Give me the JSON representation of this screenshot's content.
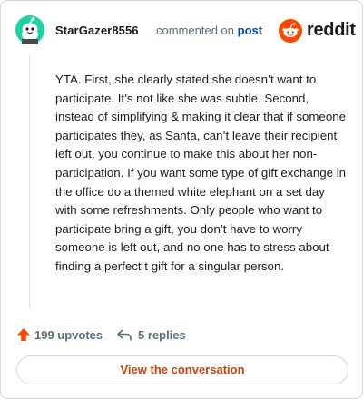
{
  "header": {
    "username": "StarGazer8556",
    "commented_text": "commented on",
    "post_link": "post",
    "brand": "reddit"
  },
  "comment": {
    "body": "YTA. First, she clearly stated she doesn’t want to participate. It’s not like she was subtle. Second, instead of simplifying & making it clear that if someone participates they, as Santa, can’t leave their recipient left out, you continue to make this about her non-participation. If you want some type of gift exchange in the office do a themed white elephant on a set day with some refreshments. Only people who want to participate bring a gift, you don’t have to worry someone is left out, and no one has to stress about finding a perfect t gift for a singular person."
  },
  "actions": {
    "upvotes": "199 upvotes",
    "replies": "5 replies"
  },
  "cta": {
    "label": "View the conversation"
  },
  "icons": {
    "avatar": "snoo-avatar-icon",
    "brand": "reddit-logo-icon",
    "upvote": "upvote-arrow-icon",
    "reply": "reply-arrow-icon"
  },
  "colors": {
    "avatar_bg": "#1dd3a3",
    "brand_orange": "#ff4500",
    "upvote": "#ff4500",
    "link": "#0045ac",
    "cta_text": "#c7440f",
    "muted": "#576f76"
  }
}
